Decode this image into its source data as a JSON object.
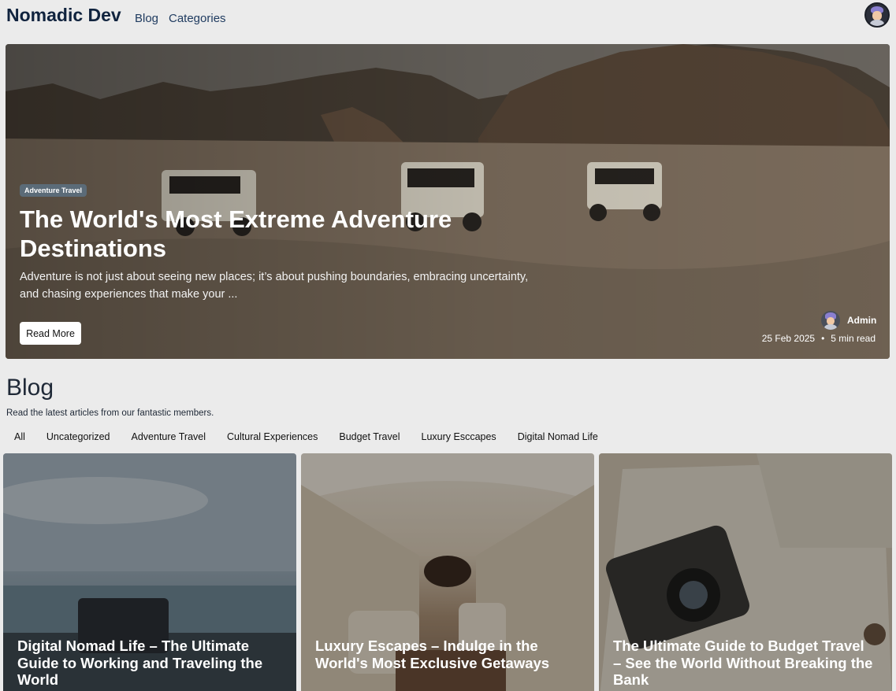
{
  "header": {
    "brand": "Nomadic Dev",
    "nav": [
      "Blog",
      "Categories"
    ]
  },
  "hero": {
    "category": "Adventure Travel",
    "title": "The World's Most Extreme Adventure Destinations",
    "excerpt": "Adventure is not just about seeing new places; it’s about pushing boundaries, embracing uncertainty, and chasing experiences that make your ...",
    "button_label": "Read More",
    "author": "Admin",
    "date": "25 Feb 2025",
    "separator": "•",
    "read_time": "5 min read"
  },
  "blog": {
    "heading": "Blog",
    "subtitle": "Read the latest articles from our fantastic members.",
    "filters": [
      "All",
      "Uncategorized",
      "Adventure Travel",
      "Cultural Experiences",
      "Budget Travel",
      "Luxury Esccapes",
      "Digital Nomad Life"
    ]
  },
  "cards": [
    {
      "title": "Digital Nomad Life – The Ultimate Guide to Working and Traveling the World"
    },
    {
      "title": "Luxury Escapes – Indulge in the World's Most Exclusive Getaways"
    },
    {
      "title": "The Ultimate Guide to Budget Travel – See the World Without Breaking the Bank"
    }
  ]
}
